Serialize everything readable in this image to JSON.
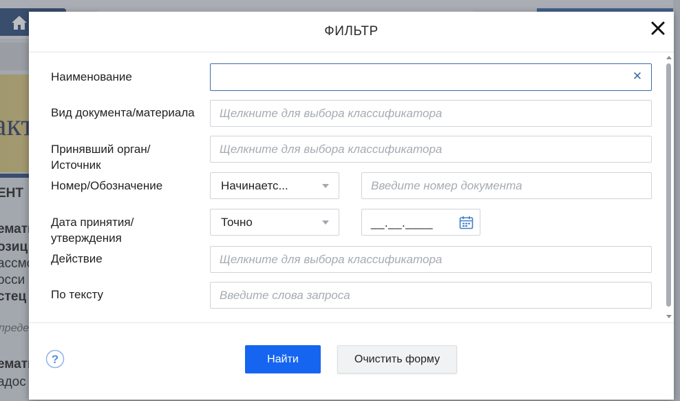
{
  "background": {
    "banner_fragment": "акт",
    "fragments": [
      {
        "text": "ЕНТ",
        "style": "bold"
      },
      {
        "text": "емати",
        "style": "bold"
      },
      {
        "text": "озиц",
        "style": "bold"
      },
      {
        "text": "ассмо",
        "style": "normal"
      },
      {
        "text": "осси",
        "style": "normal"
      },
      {
        "text": "стец",
        "style": "bold"
      },
      {
        "text": "преде",
        "style": "ital"
      },
      {
        "text": "емати",
        "style": "bold"
      },
      {
        "text": "адос",
        "style": "normal"
      }
    ]
  },
  "dialog": {
    "title": "ФИЛЬТР",
    "fields": {
      "name": {
        "label": "Наименование",
        "value": "",
        "placeholder": ""
      },
      "doc_type": {
        "label": "Вид документа/материала",
        "placeholder": "Щелкните для выбора классификатора"
      },
      "authority": {
        "label_line1": "Принявший орган/",
        "label_line2": "Источник",
        "placeholder": "Щелкните для выбора классификатора"
      },
      "number": {
        "label": "Номер/Обозначение",
        "mode": "Начинаетс...",
        "placeholder": "Введите номер документа"
      },
      "date": {
        "label_line1": "Дата принятия/",
        "label_line2": "утверждения",
        "mode": "Точно",
        "mask": "__.__.____"
      },
      "action": {
        "label": "Действие",
        "placeholder": "Щелкните для выбора классификатора"
      },
      "text": {
        "label": "По тексту",
        "placeholder": "Введите слова запроса"
      }
    },
    "buttons": {
      "find": "Найти",
      "clear": "Очистить форму"
    }
  },
  "colors": {
    "primary": "#1565f0",
    "active_border": "#3f6aa8",
    "overlay": "#50545c"
  },
  "icons": [
    "home-icon",
    "close-icon",
    "clear-icon",
    "chevron-down-icon",
    "calendar-icon",
    "help-icon"
  ]
}
